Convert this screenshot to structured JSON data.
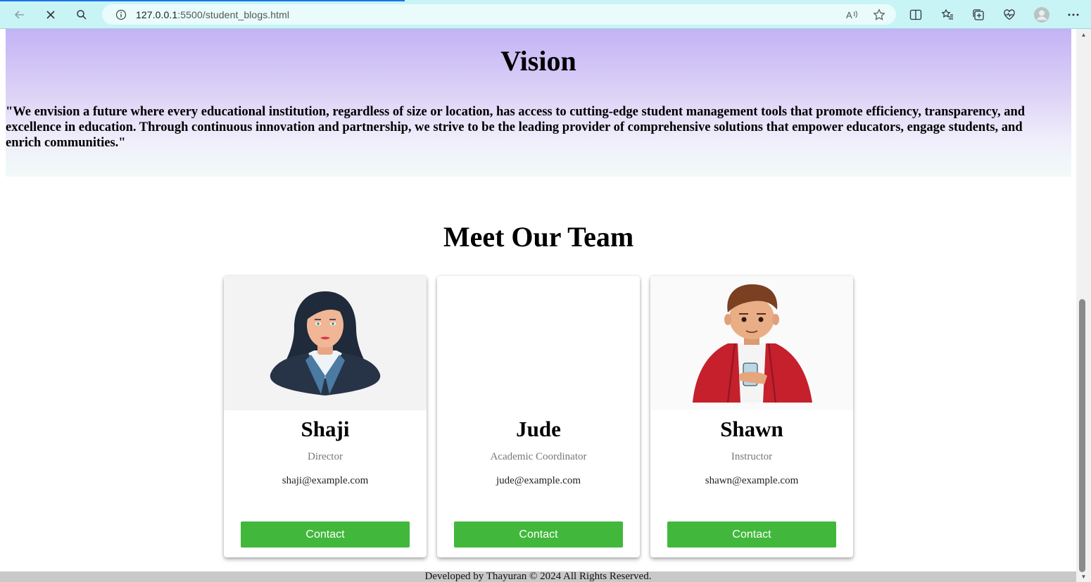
{
  "browser": {
    "url_host": "127.0.0.1",
    "url_rest": ":5500/student_blogs.html"
  },
  "vision": {
    "title": "Vision",
    "text": "\"We envision a future where every educational institution, regardless of size or location, has access to cutting-edge student management tools that promote efficiency, transparency, and excellence in education. Through continuous innovation and partnership, we strive to be the leading provider of comprehensive solutions that empower educators, engage students, and enrich communities.\""
  },
  "team": {
    "title": "Meet Our Team",
    "members": [
      {
        "name": "Shaji",
        "role": "Director",
        "email": "shaji@example.com",
        "button": "Contact",
        "avatar": "woman-avatar"
      },
      {
        "name": "Jude",
        "role": "Academic Coordinator",
        "email": "jude@example.com",
        "button": "Contact",
        "avatar": "none"
      },
      {
        "name": "Shawn",
        "role": "Instructor",
        "email": "shawn@example.com",
        "button": "Contact",
        "avatar": "man-avatar"
      }
    ]
  },
  "footer": {
    "text": "Developed by Thayuran © 2024 All Rights Reserved."
  },
  "colors": {
    "contact_button": "#41b83b",
    "vision_gradient_top": "#c3b3f5",
    "browser_chrome": "#c8f4f6"
  }
}
